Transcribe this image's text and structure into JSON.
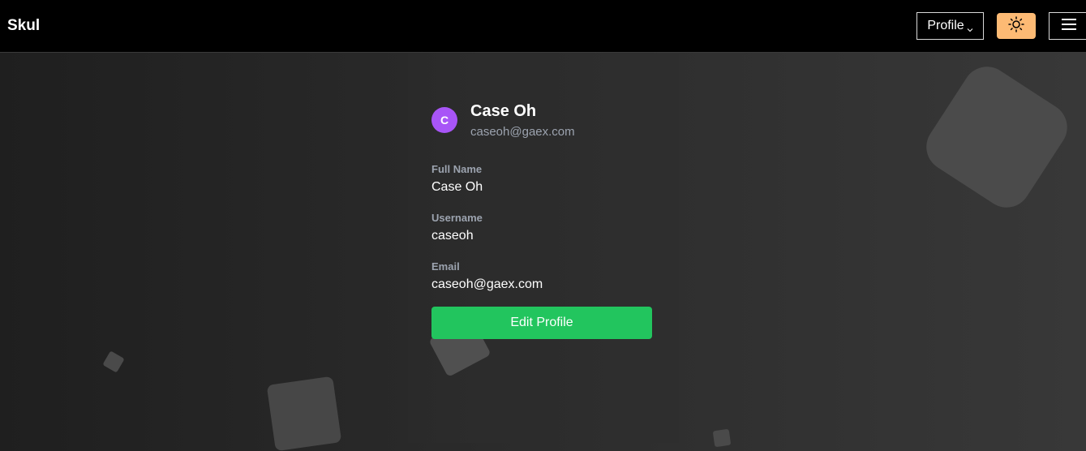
{
  "app": {
    "brand": "Skul"
  },
  "header": {
    "profile_label": "Profile",
    "profile_chevron_icon": "chevron-down-icon",
    "theme_icon": "sun-icon",
    "menu_icon": "hamburger-menu-icon",
    "theme_button_color": "#fdba74"
  },
  "profile": {
    "avatar_initial": "C",
    "avatar_color": "#a855f7",
    "name": "Case Oh",
    "email": "caseoh@gaex.com",
    "fields": [
      {
        "label": "Full Name",
        "value": "Case Oh"
      },
      {
        "label": "Username",
        "value": "caseoh"
      },
      {
        "label": "Email",
        "value": "caseoh@gaex.com"
      }
    ],
    "edit_button": "Edit Profile",
    "edit_button_color": "#22c55e"
  }
}
